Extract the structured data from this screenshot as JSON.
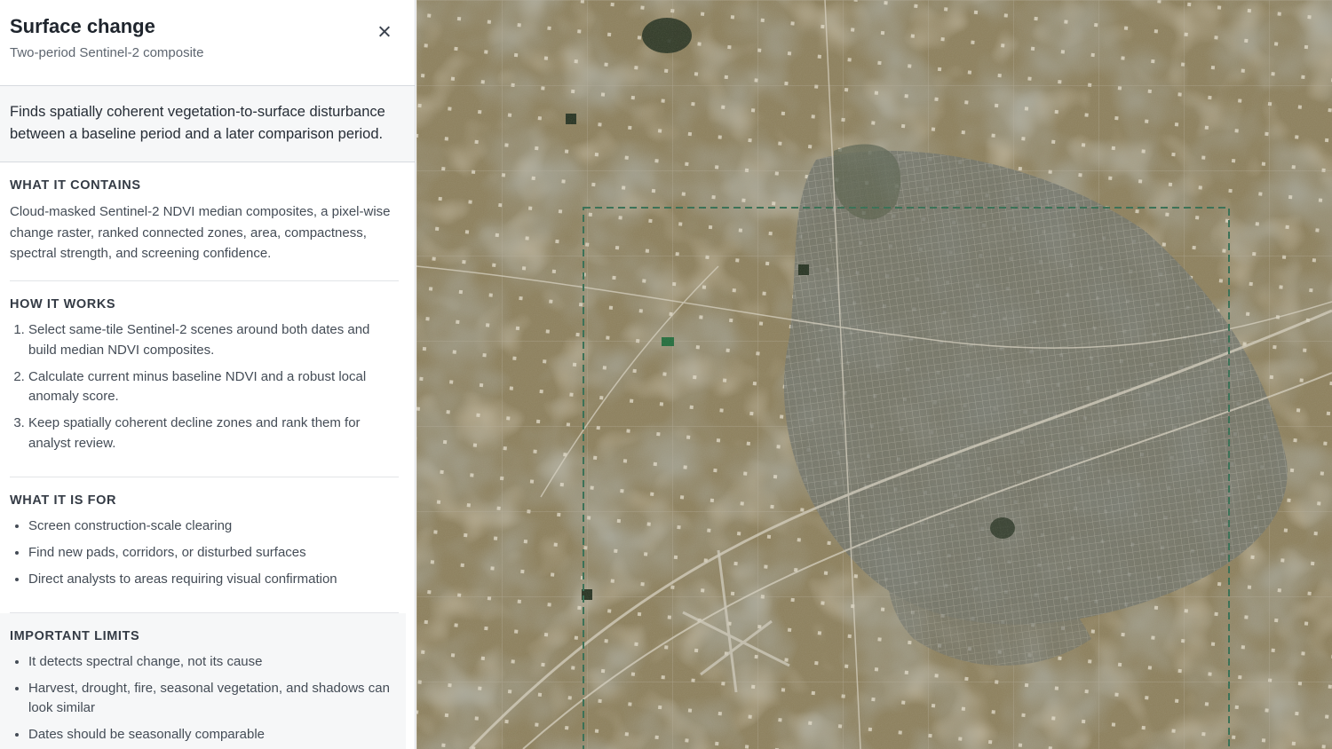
{
  "panel": {
    "title": "Surface change",
    "subtitle": "Two-period Sentinel-2 composite",
    "intro": "Finds spatially coherent vegetation-to-surface disturbance between a baseline period and a later comparison period.",
    "sections": {
      "contains": {
        "title": "WHAT IT CONTAINS",
        "text": "Cloud-masked Sentinel-2 NDVI median composites, a pixel-wise change raster, ranked connected zones, area, compactness, spectral strength, and screening confidence."
      },
      "how": {
        "title": "HOW IT WORKS",
        "items": [
          "Select same-tile Sentinel-2 scenes around both dates and build median NDVI composites.",
          "Calculate current minus baseline NDVI and a robust local anomaly score.",
          "Keep spatially coherent decline zones and rank them for analyst review."
        ]
      },
      "for": {
        "title": "WHAT IT IS FOR",
        "items": [
          "Screen construction-scale clearing",
          "Find new pads, corridors, or disturbed surfaces",
          "Direct analysts to areas requiring visual confirmation"
        ]
      },
      "limits": {
        "title": "IMPORTANT LIMITS",
        "items": [
          "It detects spectral change, not its cause",
          "Harvest, drought, fire, seasonal vegetation, and shadows can look similar",
          "Dates should be seasonally comparable"
        ]
      }
    }
  },
  "icons": {
    "close": "close-icon"
  },
  "colors": {
    "aoi_outline": "#2f6b4f",
    "terrain": "#8b7d5a",
    "urban": "#6b7068"
  }
}
